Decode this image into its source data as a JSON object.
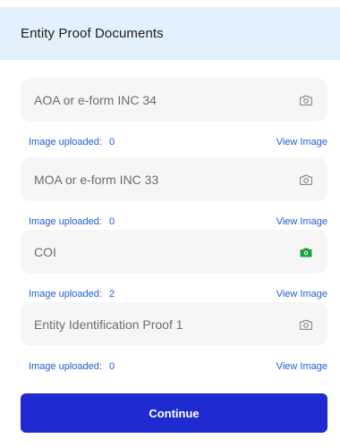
{
  "header": {
    "title": "Entity Proof Documents"
  },
  "documents": [
    {
      "label": "AOA or e-form INC 34",
      "uploaded_label": "Image uploaded:",
      "count": "0",
      "view_label": "View Image",
      "camera_color": "#8a8a8a"
    },
    {
      "label": "MOA or e-form INC 33",
      "uploaded_label": "Image uploaded:",
      "count": "0",
      "view_label": "View Image",
      "camera_color": "#8a8a8a"
    },
    {
      "label": "COI",
      "uploaded_label": "Image uploaded:",
      "count": "2",
      "view_label": "View Image",
      "camera_color": "#1aa33a"
    },
    {
      "label": "Entity Identification Proof 1",
      "uploaded_label": "Image uploaded:",
      "count": "0",
      "view_label": "View Image",
      "camera_color": "#8a8a8a"
    }
  ],
  "footer": {
    "continue_label": "Continue"
  },
  "colors": {
    "accent": "#1f2bd0",
    "link": "#1f5fcf",
    "header_bg": "#e3f1fc",
    "uploaded_icon": "#1aa33a"
  }
}
